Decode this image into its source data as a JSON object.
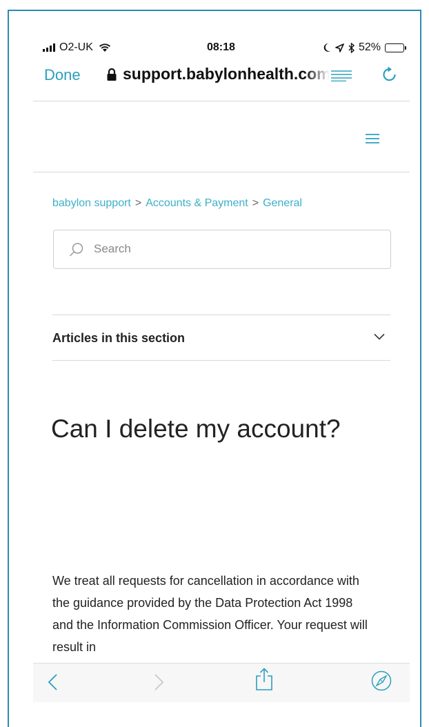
{
  "status_bar": {
    "carrier": "O2-UK",
    "time": "08:18",
    "battery": "52%",
    "battery_level": 0.52
  },
  "browser": {
    "done_label": "Done",
    "url": "support.babylonhealth.com"
  },
  "breadcrumb": {
    "items": [
      "babylon support",
      "Accounts & Payment",
      "General"
    ],
    "separator": ">"
  },
  "search": {
    "placeholder": "Search"
  },
  "articles_section": {
    "label": "Articles in this section"
  },
  "article": {
    "title": "Can I delete my account?",
    "body": "We treat all requests for cancellation in accordance with the guidance provided by the Data Protection Act 1998 and the Information Commission Officer. Your request will result in"
  },
  "colors": {
    "accent": "#2a9fbc",
    "link": "#3bb0c9",
    "frame": "#2b8bb0"
  }
}
